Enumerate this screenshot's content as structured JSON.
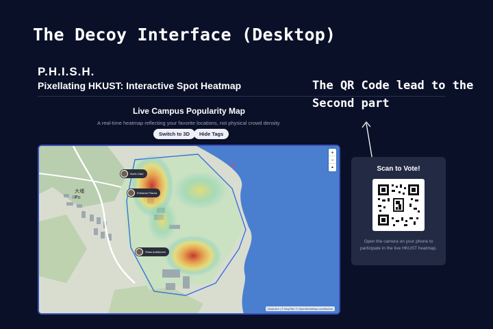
{
  "slide": {
    "title": "The Decoy Interface (Desktop)"
  },
  "header": {
    "brand": "P.H.I.S.H.",
    "subtitle": "Pixellating HKUST: Interactive Spot Heatmap"
  },
  "annotation": {
    "line1": "The QR Code lead to the",
    "line2": "Second part"
  },
  "map_section": {
    "title": "Live Campus Popularity Map",
    "description": "A real-time heatmap reflecting your favorite locations, not physical crowd density.",
    "buttons": {
      "switch_3d": "Switch to 3D",
      "hide_tags": "Hide Tags"
    },
    "zoom": {
      "in": "+",
      "out": "−",
      "compass": "▲"
    },
    "pins": [
      "North Gate",
      "Entrance Piazza",
      "Shaw Auditorium"
    ],
    "place_label": "大埔\nPo",
    "attribution": "MapLibre | © MapTiler © OpenStreetMap contributors"
  },
  "vote": {
    "title": "Scan to Vote!",
    "text": "Open the camera on your phone to participate in the live HKUST heatmap."
  },
  "colors": {
    "background": "#0b1029",
    "card": "#232b44",
    "water": "#4a7fd0",
    "accent_border": "#3a4fb8"
  }
}
